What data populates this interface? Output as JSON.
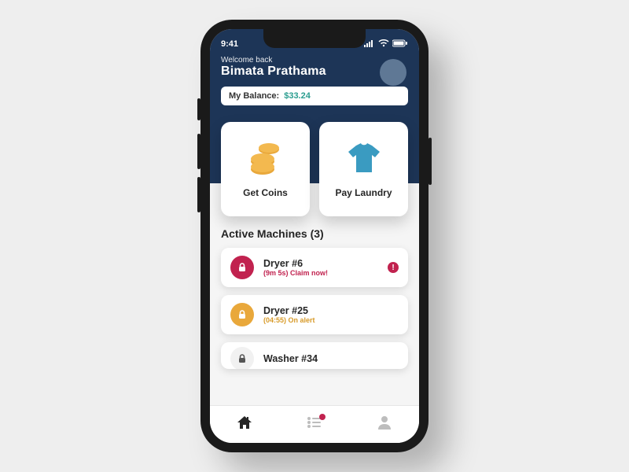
{
  "status": {
    "time": "9:41"
  },
  "welcome": {
    "greeting": "Welcome back",
    "name": "Bimata Prathama"
  },
  "balance": {
    "label": "My Balance:",
    "amount": "$33.24"
  },
  "actions": {
    "get_coins": "Get Coins",
    "pay_laundry": "Pay Laundry"
  },
  "section": {
    "title": "Active Machines (3)"
  },
  "machines": [
    {
      "name": "Dryer #6",
      "sub": "(9m 5s) Claim now!",
      "color": "red",
      "alert": true
    },
    {
      "name": "Dryer #25",
      "sub": "(04:55) On alert",
      "color": "yellow",
      "alert": false
    },
    {
      "name": "Washer #34",
      "sub": "",
      "color": "grey",
      "alert": false
    }
  ]
}
